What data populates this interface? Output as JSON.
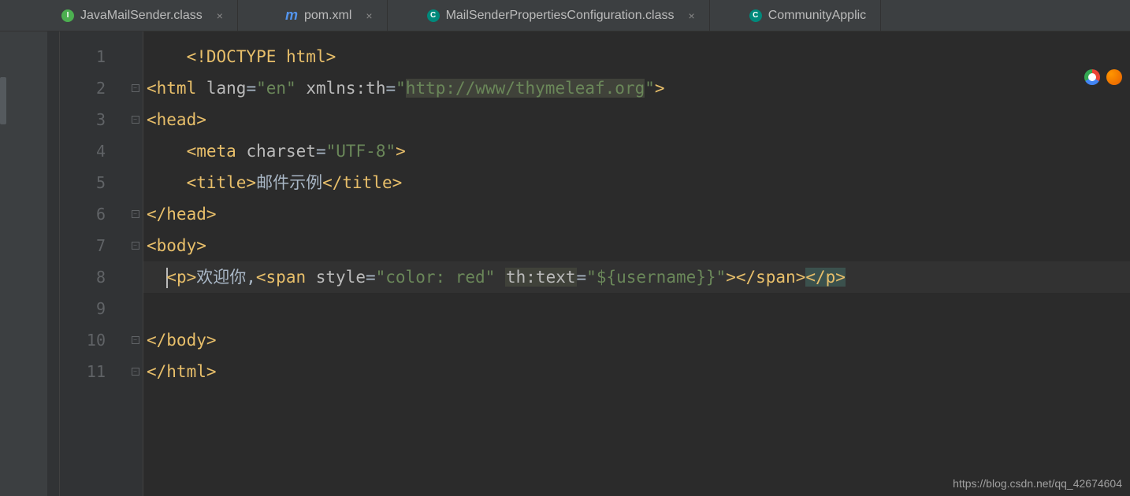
{
  "tabs": [
    {
      "icon": "java",
      "label": "JavaMailSender.class"
    },
    {
      "icon": "m",
      "label": "pom.xml"
    },
    {
      "icon": "c",
      "label": "MailSenderPropertiesConfiguration.class"
    },
    {
      "icon": "c",
      "label": "CommunityApplic"
    }
  ],
  "lines": [
    "1",
    "2",
    "3",
    "4",
    "5",
    "6",
    "7",
    "8",
    "9",
    "10",
    "11"
  ],
  "code": {
    "l1_doctype": "<!DOCTYPE html>",
    "l2_open": "<html ",
    "l2_attr1": "lang",
    "l2_eq1": "=",
    "l2_val1": "\"en\"",
    "l2_sp": " ",
    "l2_attr2": "xmlns:th",
    "l2_eq2": "=",
    "l2_q": "\"",
    "l2_url": "http://www/thymeleaf.org",
    "l2_q2": "\"",
    "l2_close": ">",
    "l3": "<head>",
    "l4_open": "<meta ",
    "l4_attr": "charset",
    "l4_eq": "=",
    "l4_val": "\"UTF-8\"",
    "l4_close": ">",
    "l5_open": "<title>",
    "l5_text": "邮件示例",
    "l5_close": "</title>",
    "l6": "</head>",
    "l7": "<body>",
    "l8_open": "<p>",
    "l8_text": "欢迎你,",
    "l8_span_open": "<span ",
    "l8_style_attr": "style",
    "l8_eq1": "=",
    "l8_style_val": "\"color: red\"",
    "l8_sp": " ",
    "l8_th_attr": "th:text",
    "l8_eq2": "=",
    "l8_th_val": "\"${username}}\"",
    "l8_span_close": ">",
    "l8_span_end": "</span>",
    "l8_p_end": "</p>",
    "l10": "</body>",
    "l11": "</html>"
  },
  "watermark": "https://blog.csdn.net/qq_42674604"
}
